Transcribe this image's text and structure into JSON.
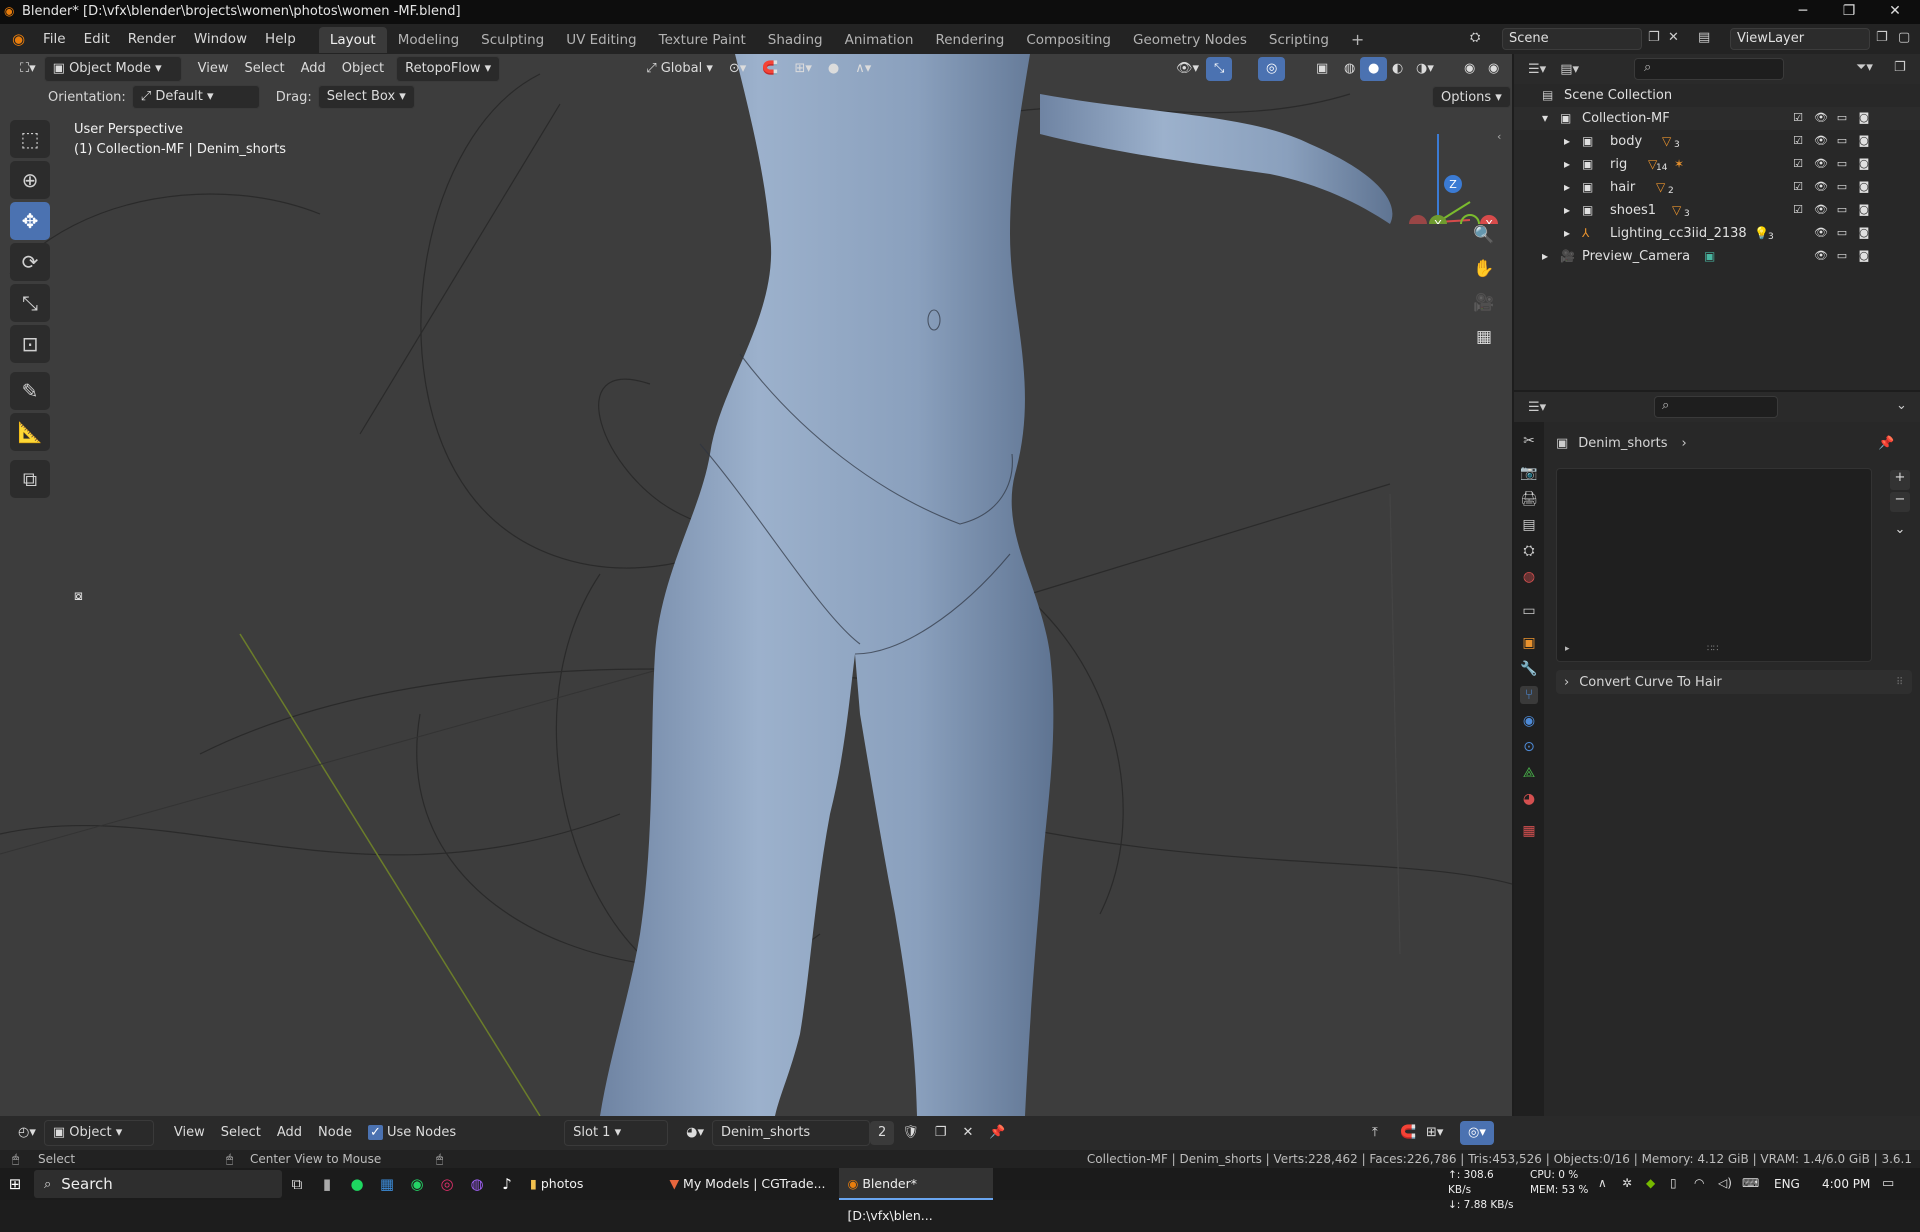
{
  "window": {
    "title": "Blender* [D:\\vfx\\blender\\brojects\\women\\photos\\women -MF.blend]",
    "minimize": "─",
    "restore": "❐",
    "close": "✕"
  },
  "menubar": {
    "menus": [
      "File",
      "Edit",
      "Render",
      "Window",
      "Help"
    ],
    "workspaces": [
      "Layout",
      "Modeling",
      "Sculpting",
      "UV Editing",
      "Texture Paint",
      "Shading",
      "Animation",
      "Rendering",
      "Compositing",
      "Geometry Nodes",
      "Scripting"
    ],
    "active_workspace": "Layout",
    "add_tab": "+",
    "scene": "Scene",
    "view_layer": "ViewLayer"
  },
  "viewport": {
    "mode": "Object Mode",
    "menus": [
      "View",
      "Select",
      "Add",
      "Object"
    ],
    "addon_menu": "RetopoFlow",
    "transform_orientation": "Global",
    "orientation_label": "Orientation:",
    "orientation_value": "Default",
    "drag_label": "Drag:",
    "drag_value": "Select Box",
    "options": "Options",
    "overlay_line1": "User Perspective",
    "overlay_line2": "(1) Collection-MF | Denim_shorts",
    "gizmo": {
      "z": "Z",
      "y": "Y",
      "x": "X"
    }
  },
  "outliner": {
    "search_placeholder": "",
    "root": "Scene Collection",
    "collection": "Collection-MF",
    "items": [
      {
        "name": "body",
        "badge": "3"
      },
      {
        "name": "rig",
        "badge": "14"
      },
      {
        "name": "hair",
        "badge": "2"
      },
      {
        "name": "shoes1",
        "badge": "3"
      },
      {
        "name": "Lighting_cc3iid_2138",
        "badge": "3"
      }
    ],
    "camera": "Preview_Camera"
  },
  "properties": {
    "object": "Denim_shorts",
    "panel": "Convert Curve To Hair"
  },
  "node_header": {
    "editor_type": "Object",
    "menus": [
      "View",
      "Select",
      "Add",
      "Node"
    ],
    "use_nodes": "Use Nodes",
    "slot": "Slot 1",
    "material": "Denim_shorts",
    "users": "2"
  },
  "statusbar": {
    "select": "Select",
    "center": "Center View to Mouse",
    "info": "Collection-MF | Denim_shorts | Verts:228,462 | Faces:226,786 | Tris:453,526 | Objects:0/16 | Memory: 4.12 GiB | VRAM: 1.4/6.0 GiB | 3.6.1"
  },
  "taskbar": {
    "search": "Search",
    "apps": [
      "photos",
      "My Models | CGTrade...",
      "Blender* [D:\\vfx\\blen..."
    ],
    "net_up": "↑: 308.6 KB/s",
    "net_down": "↓: 7.88 KB/s",
    "cpu": "CPU: 0 %",
    "mem": "MEM: 53 %",
    "lang": "ENG",
    "time": "4:00 PM"
  },
  "colors": {
    "accent": "#4b72b1",
    "body": "#8fa3bf",
    "viewport": "#3d3d3d",
    "orange": "#e8922e"
  }
}
